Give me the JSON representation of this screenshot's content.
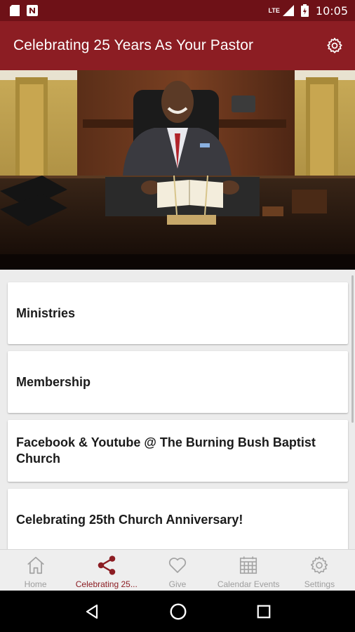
{
  "status_bar": {
    "network": "LTE",
    "time": "10:05"
  },
  "app_bar": {
    "title": "Celebrating 25 Years As Your Pastor",
    "settings_icon": "gear-icon"
  },
  "hero": {
    "description_icon": "pastor-photo"
  },
  "list": {
    "items": [
      {
        "label": "Ministries"
      },
      {
        "label": "Membership"
      },
      {
        "label": "Facebook & Youtube @ The Burning Bush Baptist Church"
      },
      {
        "label": "Celebrating 25th Church Anniversary!"
      }
    ]
  },
  "bottom_nav": {
    "items": [
      {
        "label": "Home",
        "icon": "home-icon",
        "active": false
      },
      {
        "label": "Celebrating 25...",
        "icon": "share-icon",
        "active": true
      },
      {
        "label": "Give",
        "icon": "heart-icon",
        "active": false
      },
      {
        "label": "Calendar Events",
        "icon": "calendar-icon",
        "active": false
      },
      {
        "label": "Settings",
        "icon": "gear-icon",
        "active": false
      }
    ]
  },
  "colors": {
    "primary": "#8c1d23",
    "status_bar": "#6e1117",
    "inactive": "#9e9e9e"
  }
}
